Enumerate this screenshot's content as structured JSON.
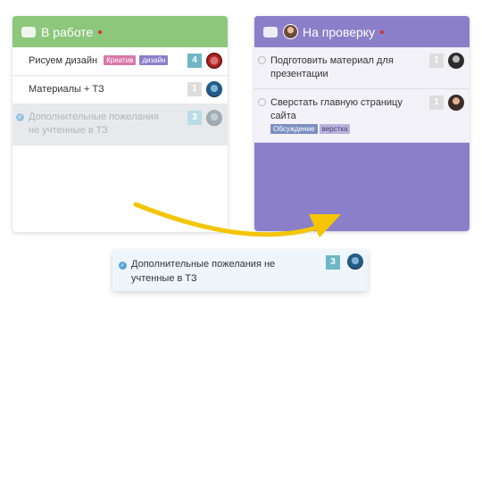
{
  "colors": {
    "left_header": "#8cc77c",
    "right_header": "#8b7fca",
    "header_dot": "#d9322c",
    "count_teal": "#6fb7c7",
    "count_grey": "#dddddd",
    "tag_pink": "#d877a8",
    "tag_purple": "#8b7fca",
    "tag_blue": "#7b8fc2",
    "tag_lavender": "#b9b2dd",
    "arrow": "#f4c500"
  },
  "columns": [
    {
      "title": "В работе",
      "cards": [
        {
          "title": "Рисуем дизайн",
          "tags": [
            "Креатив",
            "дизайн"
          ],
          "count": "4",
          "avatar": "user-avatar"
        },
        {
          "title": "Материалы + ТЗ",
          "tags": [],
          "count": "1",
          "avatar": "user-avatar"
        },
        {
          "title": "Дополнительные пожелания не учтенные в ТЗ",
          "tags": [],
          "count": "3",
          "avatar": "user-avatar",
          "state": "dragging-placeholder"
        }
      ]
    },
    {
      "title": "На проверку",
      "cards": [
        {
          "title": "Подготовить материал для презентации",
          "tags": [],
          "count": "1",
          "avatar": "user-avatar"
        },
        {
          "title": "Сверстать главную страницу сайта",
          "tags": [
            "Обсуждение",
            "верстка"
          ],
          "count": "1",
          "avatar": "user-avatar"
        }
      ]
    }
  ],
  "dragged_card": {
    "title": "Дополнительные пожелания не учтенные в ТЗ",
    "count": "3",
    "avatar": "user-avatar",
    "icon": "check-circle-icon"
  }
}
